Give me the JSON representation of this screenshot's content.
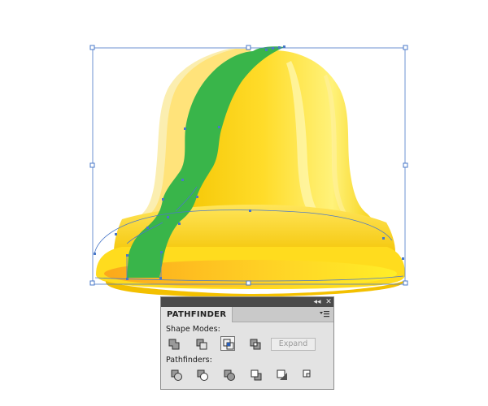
{
  "panel": {
    "tab_label": "PATHFINDER",
    "collapse_glyph": "◂◂",
    "close_glyph": "✕",
    "shape_modes_label": "Shape Modes:",
    "pathfinders_label": "Pathfinders:",
    "expand_label": "Expand",
    "shape_mode_buttons": [
      "unite",
      "minus-front",
      "intersect",
      "exclude"
    ],
    "pathfinder_buttons": [
      "divide",
      "trim",
      "merge",
      "crop",
      "outline",
      "minus-back"
    ],
    "active_shape_mode": "intersect"
  },
  "colors": {
    "bell_yellow": "#ffe033",
    "bell_shadow": "#f2c400",
    "bell_lip_orange": "#fdb317",
    "green_shape": "#39b54a",
    "selection_blue": "#4a78c8",
    "panel_bg": "#e3e3e3",
    "panel_topbar": "#4a4a4a"
  }
}
